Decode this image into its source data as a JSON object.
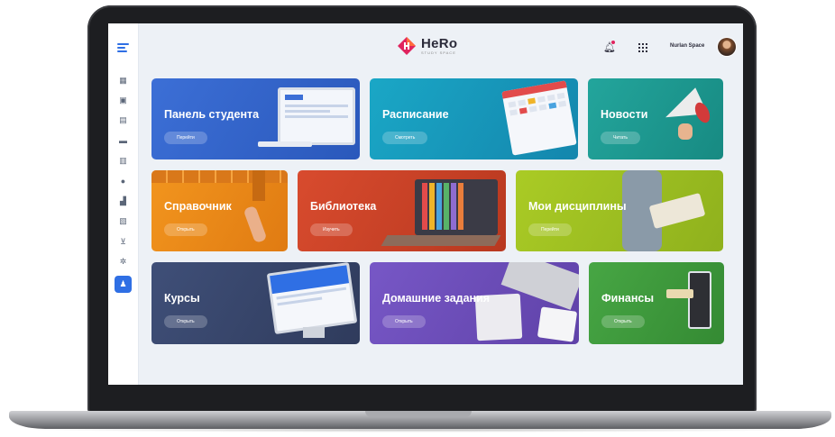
{
  "app": {
    "logo_title": "HeRo",
    "logo_subtitle": "STUDY SPACE",
    "user_name": "Nurlan Space"
  },
  "sidebar": {
    "icons": [
      "menu-icon",
      "dashboard-icon",
      "calendar-icon",
      "news-icon",
      "book-icon",
      "library-icon",
      "course-icon",
      "stats-icon",
      "folder-icon",
      "cart-icon",
      "settings-icon",
      "profile-icon"
    ],
    "active": "profile-icon"
  },
  "cards": [
    {
      "id": "student-panel",
      "title": "Панель студента",
      "button": "Перейти",
      "color": "#2f62c8"
    },
    {
      "id": "schedule",
      "title": "Расписание",
      "button": "Смотреть",
      "color": "#1b9bbc"
    },
    {
      "id": "news",
      "title": "Новости",
      "button": "Читать",
      "color": "#1f9b92"
    },
    {
      "id": "reference",
      "title": "Справочник",
      "button": "Открыть",
      "color": "#ee8a19"
    },
    {
      "id": "library",
      "title": "Библиотека",
      "button": "Изучить",
      "color": "#d0452c"
    },
    {
      "id": "my-disciplines",
      "title": "Мои дисциплины",
      "button": "Перейти",
      "color": "#9cbd24"
    },
    {
      "id": "courses",
      "title": "Курсы",
      "button": "Открыть",
      "color": "#37476d"
    },
    {
      "id": "homework",
      "title": "Домашние задания",
      "button": "Открыть",
      "color": "#6e4fb8"
    },
    {
      "id": "finance",
      "title": "Финансы",
      "button": "Открыть",
      "color": "#3c9a3a"
    }
  ]
}
